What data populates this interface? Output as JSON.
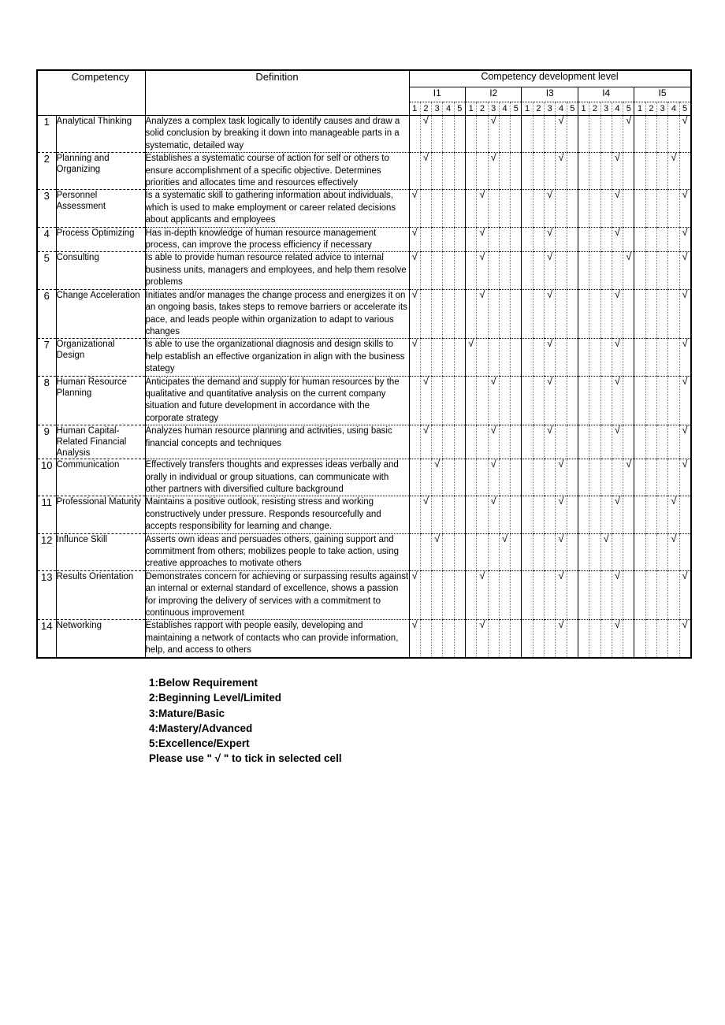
{
  "table": {
    "headers": {
      "number": "",
      "competency": "Competency",
      "definition": "Definition",
      "development_level": "Competency development level",
      "groups": [
        "I1",
        "I2",
        "I3",
        "I4",
        "I5"
      ],
      "levels": [
        "1",
        "2",
        "3",
        "4",
        "5"
      ]
    },
    "tick_glyph": "√",
    "rows": [
      {
        "no": "1",
        "competency": "Analytical Thinking",
        "definition": "Analyzes a complex task logically to identify causes and draw a solid conclusion by breaking it down into manageable parts in a systematic, detailed way",
        "ratings": {
          "I1": 2,
          "I2": 3,
          "I3": 4,
          "I4": 5,
          "I5": 5
        }
      },
      {
        "no": "2",
        "competency": "Planning and Organizing",
        "definition": "Establishes a systematic course of action for self or others to ensure accomplishment of a specific objective.  Determines priorities and allocates time and resources effectively",
        "ratings": {
          "I1": 2,
          "I2": 3,
          "I3": 4,
          "I4": 4,
          "I5": 4
        }
      },
      {
        "no": "3",
        "competency": "Personnel Assessment",
        "definition": "Is a systematic skill to gathering information about individuals, which is used to make employment or career related decisions about applicants and employees",
        "ratings": {
          "I1": 1,
          "I2": 2,
          "I3": 3,
          "I4": 4,
          "I5": 5
        }
      },
      {
        "no": "4",
        "competency": "Process Optimizing",
        "definition": "Has in-depth knowledge of human resource management process, can improve the process efficiency if necessary",
        "ratings": {
          "I1": 1,
          "I2": 2,
          "I3": 3,
          "I4": 4,
          "I5": 5
        }
      },
      {
        "no": "5",
        "competency": "Consulting",
        "definition": "Is able to provide human resource related advice to internal business units, managers and employees, and help them resolve problems",
        "ratings": {
          "I1": 1,
          "I2": 2,
          "I3": 3,
          "I4": 5,
          "I5": 5
        }
      },
      {
        "no": "6",
        "competency": "Change Acceleration",
        "definition": "Initiates and/or manages the change process and energizes it on an ongoing basis, takes steps to remove barriers or accelerate its pace, and leads people within organization to adapt to various changes",
        "ratings": {
          "I1": 1,
          "I2": 2,
          "I3": 3,
          "I4": 4,
          "I5": 5
        }
      },
      {
        "no": "7",
        "competency": "Organizational Design",
        "definition": "Is able to use the organizational diagnosis and design skills to help establish an effective organization in align with the business stategy",
        "ratings": {
          "I1": 1,
          "I2": 1,
          "I3": 3,
          "I4": 4,
          "I5": 5
        }
      },
      {
        "no": "8",
        "competency": "Human Resource Planning",
        "definition": "Anticipates the demand and supply for human resources by the qualitative and quantitative analysis on the current company situation and future development in accordance with the corporate strategy",
        "ratings": {
          "I1": 2,
          "I2": 3,
          "I3": 3,
          "I4": 4,
          "I5": 5
        }
      },
      {
        "no": "9",
        "competency": "Human Capital-Related Financial Analysis",
        "definition": "Analyzes human resource planning and activities, using basic financial concepts and techniques",
        "ratings": {
          "I1": 2,
          "I2": 3,
          "I3": 3,
          "I4": 4,
          "I5": 5
        }
      },
      {
        "no": "10",
        "competency": "Communication",
        "definition": "Effectively transfers thoughts and expresses ideas verbally and orally in individual or group situations, can communicate with other partners with diversified culture background",
        "ratings": {
          "I1": 3,
          "I2": 3,
          "I3": 4,
          "I4": 5,
          "I5": 5
        }
      },
      {
        "no": "11",
        "competency": "Professional Maturity",
        "definition": "Maintains a positive outlook, resisting stress and working constructively under pressure.  Responds resourcefully and accepts responsibility for learning and change.",
        "ratings": {
          "I1": 2,
          "I2": 3,
          "I3": 4,
          "I4": 4,
          "I5": 4
        }
      },
      {
        "no": "12",
        "competency": "Influnce Skill",
        "definition": "Asserts own ideas and persuades others, gaining support and commitment from others; mobilizes people to take action, using creative approaches to motivate others",
        "ratings": {
          "I1": 3,
          "I2": 4,
          "I3": 4,
          "I4": 3,
          "I5": 4
        }
      },
      {
        "no": "13",
        "competency": "Results Orientation",
        "definition": "Demonstrates concern for achieving or surpassing results against an internal or external standard of excellence, shows a passion for improving the delivery of services with a commitment to continuous improvement",
        "ratings": {
          "I1": 1,
          "I2": 2,
          "I3": 4,
          "I4": 4,
          "I5": 5
        }
      },
      {
        "no": "14",
        "competency": "Networking",
        "definition": "Establishes rapport with people easily, developing and maintaining a network of contacts who can provide information, help, and access to others",
        "ratings": {
          "I1": 1,
          "I2": 2,
          "I3": 4,
          "I4": 4,
          "I5": 5
        }
      }
    ]
  },
  "legend": {
    "lines": [
      "1:Below Requirement",
      "2:Beginning Level/Limited",
      "3:Mature/Basic",
      "4:Mastery/Advanced",
      "5:Excellence/Expert",
      "Please use \" √ \" to tick in selected cell"
    ]
  }
}
